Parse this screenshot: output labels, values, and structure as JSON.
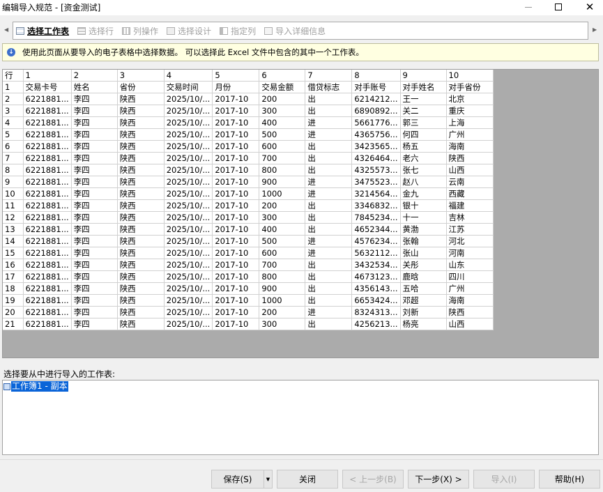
{
  "window": {
    "title": "编辑导入规范 - [资金测试]"
  },
  "tabs": [
    {
      "label": "选择工作表",
      "icon": "sheet-icon",
      "active": true
    },
    {
      "label": "选择行",
      "icon": "rows-icon",
      "active": false
    },
    {
      "label": "列操作",
      "icon": "columns-icon",
      "active": false
    },
    {
      "label": "选择设计",
      "icon": "design-icon",
      "active": false
    },
    {
      "label": "指定列",
      "icon": "specify-column-icon",
      "active": false
    },
    {
      "label": "导入详细信息",
      "icon": "details-icon",
      "active": false
    }
  ],
  "info": {
    "text": "使用此页面从要导入的电子表格中选择数据。 可以选择此 Excel 文件中包含的其中一个工作表。"
  },
  "grid": {
    "corner": "行",
    "columns": [
      "1",
      "2",
      "3",
      "4",
      "5",
      "6",
      "7",
      "8",
      "9",
      "10"
    ],
    "rows": [
      [
        "1",
        "交易卡号",
        "姓名",
        "省份",
        "交易时间",
        "月份",
        "交易金额",
        "借贷标志",
        "对手账号",
        "对手姓名",
        "对手省份"
      ],
      [
        "2",
        "6221881...",
        "李四",
        "陕西",
        "2025/10/...",
        "2017-10",
        "200",
        "出",
        "6214212...",
        "王一",
        "北京"
      ],
      [
        "3",
        "6221881...",
        "李四",
        "陕西",
        "2025/10/...",
        "2017-10",
        "300",
        "出",
        "6890892...",
        "关二",
        "重庆"
      ],
      [
        "4",
        "6221881...",
        "李四",
        "陕西",
        "2025/10/...",
        "2017-10",
        "400",
        "进",
        "5661776...",
        "郭三",
        "上海"
      ],
      [
        "5",
        "6221881...",
        "李四",
        "陕西",
        "2025/10/...",
        "2017-10",
        "500",
        "进",
        "4365756...",
        "何四",
        "广州"
      ],
      [
        "6",
        "6221881...",
        "李四",
        "陕西",
        "2025/10/...",
        "2017-10",
        "600",
        "出",
        "3423565...",
        "杨五",
        "海南"
      ],
      [
        "7",
        "6221881...",
        "李四",
        "陕西",
        "2025/10/...",
        "2017-10",
        "700",
        "出",
        "4326464...",
        "老六",
        "陕西"
      ],
      [
        "8",
        "6221881...",
        "李四",
        "陕西",
        "2025/10/...",
        "2017-10",
        "800",
        "出",
        "4325573...",
        "张七",
        "山西"
      ],
      [
        "9",
        "6221881...",
        "李四",
        "陕西",
        "2025/10/...",
        "2017-10",
        "900",
        "进",
        "3475523...",
        "赵八",
        "云南"
      ],
      [
        "10",
        "6221881...",
        "李四",
        "陕西",
        "2025/10/...",
        "2017-10",
        "1000",
        "进",
        "3214564...",
        "金九",
        "西藏"
      ],
      [
        "11",
        "6221881...",
        "李四",
        "陕西",
        "2025/10/...",
        "2017-10",
        "200",
        "出",
        "3346832...",
        "银十",
        "福建"
      ],
      [
        "12",
        "6221881...",
        "李四",
        "陕西",
        "2025/10/...",
        "2017-10",
        "300",
        "出",
        "7845234...",
        "十一",
        "吉林"
      ],
      [
        "13",
        "6221881...",
        "李四",
        "陕西",
        "2025/10/...",
        "2017-10",
        "400",
        "出",
        "4652344...",
        "黄渤",
        "江苏"
      ],
      [
        "14",
        "6221881...",
        "李四",
        "陕西",
        "2025/10/...",
        "2017-10",
        "500",
        "进",
        "4576234...",
        "张翰",
        "河北"
      ],
      [
        "15",
        "6221881...",
        "李四",
        "陕西",
        "2025/10/...",
        "2017-10",
        "600",
        "进",
        "5632112...",
        "张山",
        "河南"
      ],
      [
        "16",
        "6221881...",
        "李四",
        "陕西",
        "2025/10/...",
        "2017-10",
        "700",
        "出",
        "3432534...",
        "关彤",
        "山东"
      ],
      [
        "17",
        "6221881...",
        "李四",
        "陕西",
        "2025/10/...",
        "2017-10",
        "800",
        "出",
        "4673123...",
        "鹿晗",
        "四川"
      ],
      [
        "18",
        "6221881...",
        "李四",
        "陕西",
        "2025/10/...",
        "2017-10",
        "900",
        "出",
        "4356143...",
        "五哈",
        "广州"
      ],
      [
        "19",
        "6221881...",
        "李四",
        "陕西",
        "2025/10/...",
        "2017-10",
        "1000",
        "出",
        "6653424...",
        "邓超",
        "海南"
      ],
      [
        "20",
        "6221881...",
        "李四",
        "陕西",
        "2025/10/...",
        "2017-10",
        "200",
        "进",
        "8324313...",
        "刘新",
        "陕西"
      ],
      [
        "21",
        "6221881...",
        "李四",
        "陕西",
        "2025/10/...",
        "2017-10",
        "300",
        "出",
        "4256213...",
        "杨亮",
        "山西"
      ]
    ]
  },
  "sheet_select": {
    "label": "选择要从中进行导入的工作表:",
    "items": [
      "工作簿1 - 副本"
    ]
  },
  "buttons": {
    "save": "保存(S)",
    "close": "关闭",
    "prev": "< 上一步(B)",
    "next": "下一步(X) >",
    "import": "导入(I)",
    "help": "帮助(H)"
  }
}
